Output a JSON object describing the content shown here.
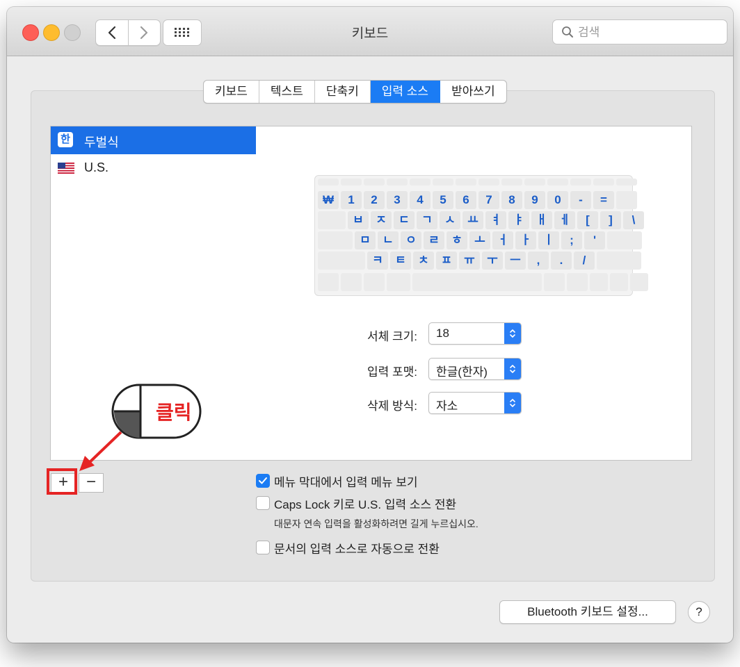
{
  "window": {
    "title": "키보드"
  },
  "search": {
    "placeholder": "검색"
  },
  "tabs": [
    {
      "label": "키보드"
    },
    {
      "label": "텍스트"
    },
    {
      "label": "단축키"
    },
    {
      "label": "입력 소스",
      "selected": true
    },
    {
      "label": "받아쓰기"
    }
  ],
  "sources": [
    {
      "label": "두벌식",
      "icon": "hangul-icon",
      "icon_text": "한",
      "selected": true
    },
    {
      "label": "U.S.",
      "icon": "us-flag-icon"
    }
  ],
  "keyboard": {
    "row1": [
      "₩",
      "1",
      "2",
      "3",
      "4",
      "5",
      "6",
      "7",
      "8",
      "9",
      "0",
      "-",
      "="
    ],
    "row2": [
      "ㅂ",
      "ㅈ",
      "ㄷ",
      "ㄱ",
      "ㅅ",
      "ㅛ",
      "ㅕ",
      "ㅑ",
      "ㅐ",
      "ㅔ",
      "[",
      "]",
      "\\"
    ],
    "row3": [
      "ㅁ",
      "ㄴ",
      "ㅇ",
      "ㄹ",
      "ㅎ",
      "ㅗ",
      "ㅓ",
      "ㅏ",
      "ㅣ",
      ";",
      "'"
    ],
    "row4": [
      "ㅋ",
      "ㅌ",
      "ㅊ",
      "ㅍ",
      "ㅠ",
      "ㅜ",
      "ㅡ",
      ",",
      ".",
      "/"
    ]
  },
  "settings": {
    "font_size": {
      "label": "서체 크기:",
      "value": "18"
    },
    "input_format": {
      "label": "입력 포맷:",
      "value": "한글(한자)"
    },
    "delete_mode": {
      "label": "삭제 방식:",
      "value": "자소"
    }
  },
  "buttons": {
    "plus": "+",
    "minus": "−",
    "bluetooth": "Bluetooth 키보드 설정...",
    "help": "?"
  },
  "checks": {
    "show_menu": {
      "label": "메뉴 막대에서 입력 메뉴 보기",
      "checked": true
    },
    "caps_lock": {
      "label": "Caps Lock 키로 U.S. 입력 소스 전환",
      "checked": false,
      "sub": "대문자 연속 입력을 활성화하려면 길게 누르십시오."
    },
    "auto_switch": {
      "label": "문서의 입력 소스로 자동으로 전환",
      "checked": false
    }
  },
  "annotation": {
    "label": "클릭"
  },
  "colors": {
    "accent": "#1b7cf4",
    "annotation": "#e52424"
  }
}
